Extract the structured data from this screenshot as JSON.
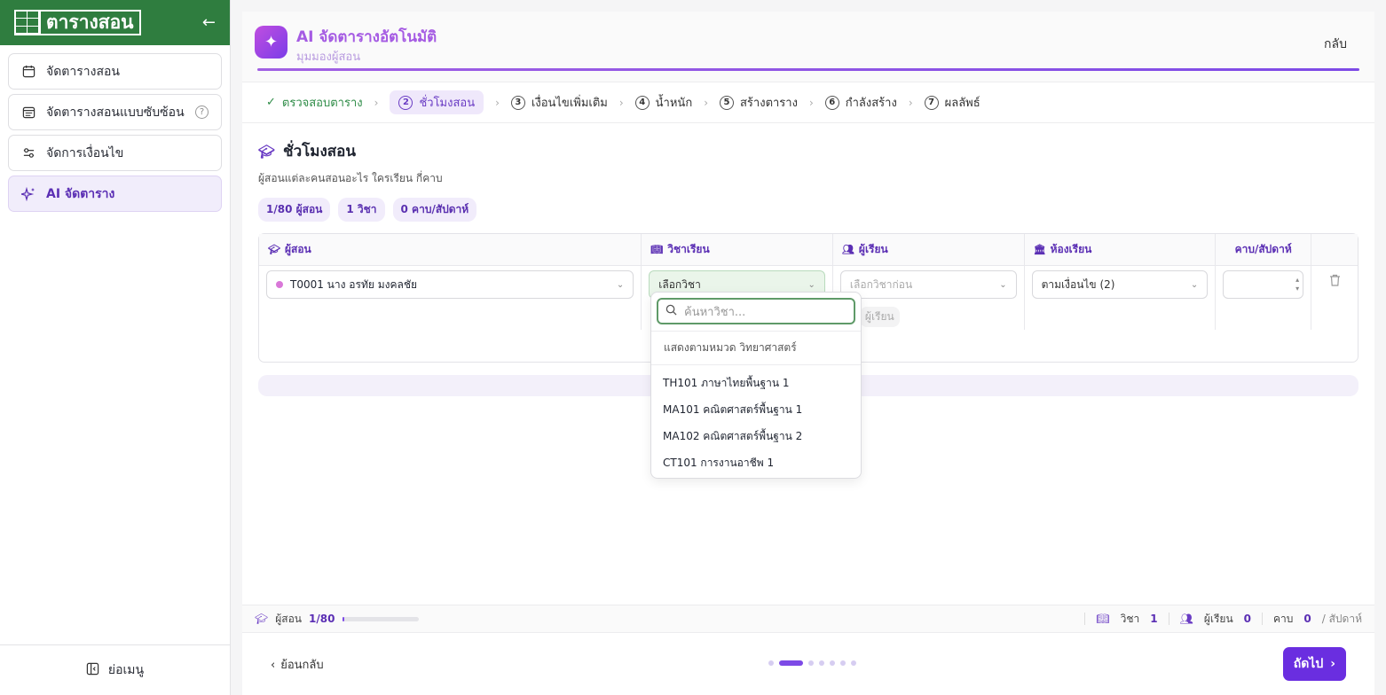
{
  "sidebar": {
    "logo": "ตารางสอน",
    "items": [
      {
        "label": "จัดตารางสอน"
      },
      {
        "label": "จัดตารางสอนแบบซับซ้อน"
      },
      {
        "label": "จัดการเงื่อนไข"
      },
      {
        "label": "AI จัดตาราง"
      }
    ],
    "collapse": "ย่อเมนู"
  },
  "header": {
    "title": "AI จัดตารางอัตโนมัติ",
    "subtitle": "มุมมองผู้สอน",
    "back": "กลับ"
  },
  "steps": [
    {
      "label": "ตรวจสอบตาราง",
      "state": "done"
    },
    {
      "num": "2",
      "label": "ชั่วโมงสอน",
      "state": "current"
    },
    {
      "num": "3",
      "label": "เงื่อนไขเพิ่มเติม"
    },
    {
      "num": "4",
      "label": "น้ำหนัก"
    },
    {
      "num": "5",
      "label": "สร้างตาราง"
    },
    {
      "num": "6",
      "label": "กำลังสร้าง"
    },
    {
      "num": "7",
      "label": "ผลลัพธ์"
    }
  ],
  "section": {
    "title": "ชั่วโมงสอน",
    "subtitle": "ผู้สอนแต่ละคนสอนอะไร ใครเรียน กี่คาบ",
    "chips": [
      "1/80 ผู้สอน",
      "1 วิชา",
      "0 คาบ/สัปดาห์"
    ]
  },
  "table": {
    "headers": [
      "ผู้สอน",
      "วิชาเรียน",
      "ผู้เรียน",
      "ห้องเรียน",
      "คาบ/สัปดาห์"
    ],
    "row": {
      "teacher": "T0001 นาง อรทัย มงคลชัย",
      "subject": "เลือกวิชา",
      "learner": "เลือกวิชาก่อน",
      "room": "ตามเงื่อนไข (2)",
      "learner_pill": "ผู้เรียน"
    }
  },
  "dropdown": {
    "placeholder": "ค้นหาวิชา...",
    "category": "แสดงตามหมวด วิทยาศาสตร์",
    "options": [
      "TH101 ภาษาไทยพื้นฐาน 1",
      "MA101 คณิตศาสตร์พื้นฐาน 1",
      "MA102 คณิตศาสตร์พื้นฐาน 2",
      "CT101 การงานอาชีพ 1"
    ]
  },
  "status": {
    "teacher_label": "ผู้สอน",
    "teacher_value": "1/80",
    "progress_fraction": 0.0125,
    "subject_label": "วิชา",
    "subject_value": "1",
    "learner_label": "ผู้เรียน",
    "learner_value": "0",
    "period_label": "คาบ",
    "period_value": "0",
    "period_unit": "/ สัปดาห์"
  },
  "footer": {
    "back": "ย้อนกลับ",
    "next": "ถัดไป"
  },
  "colors": {
    "brand_green": "#2f7d3f",
    "accent_purple": "#6a2ee0"
  }
}
